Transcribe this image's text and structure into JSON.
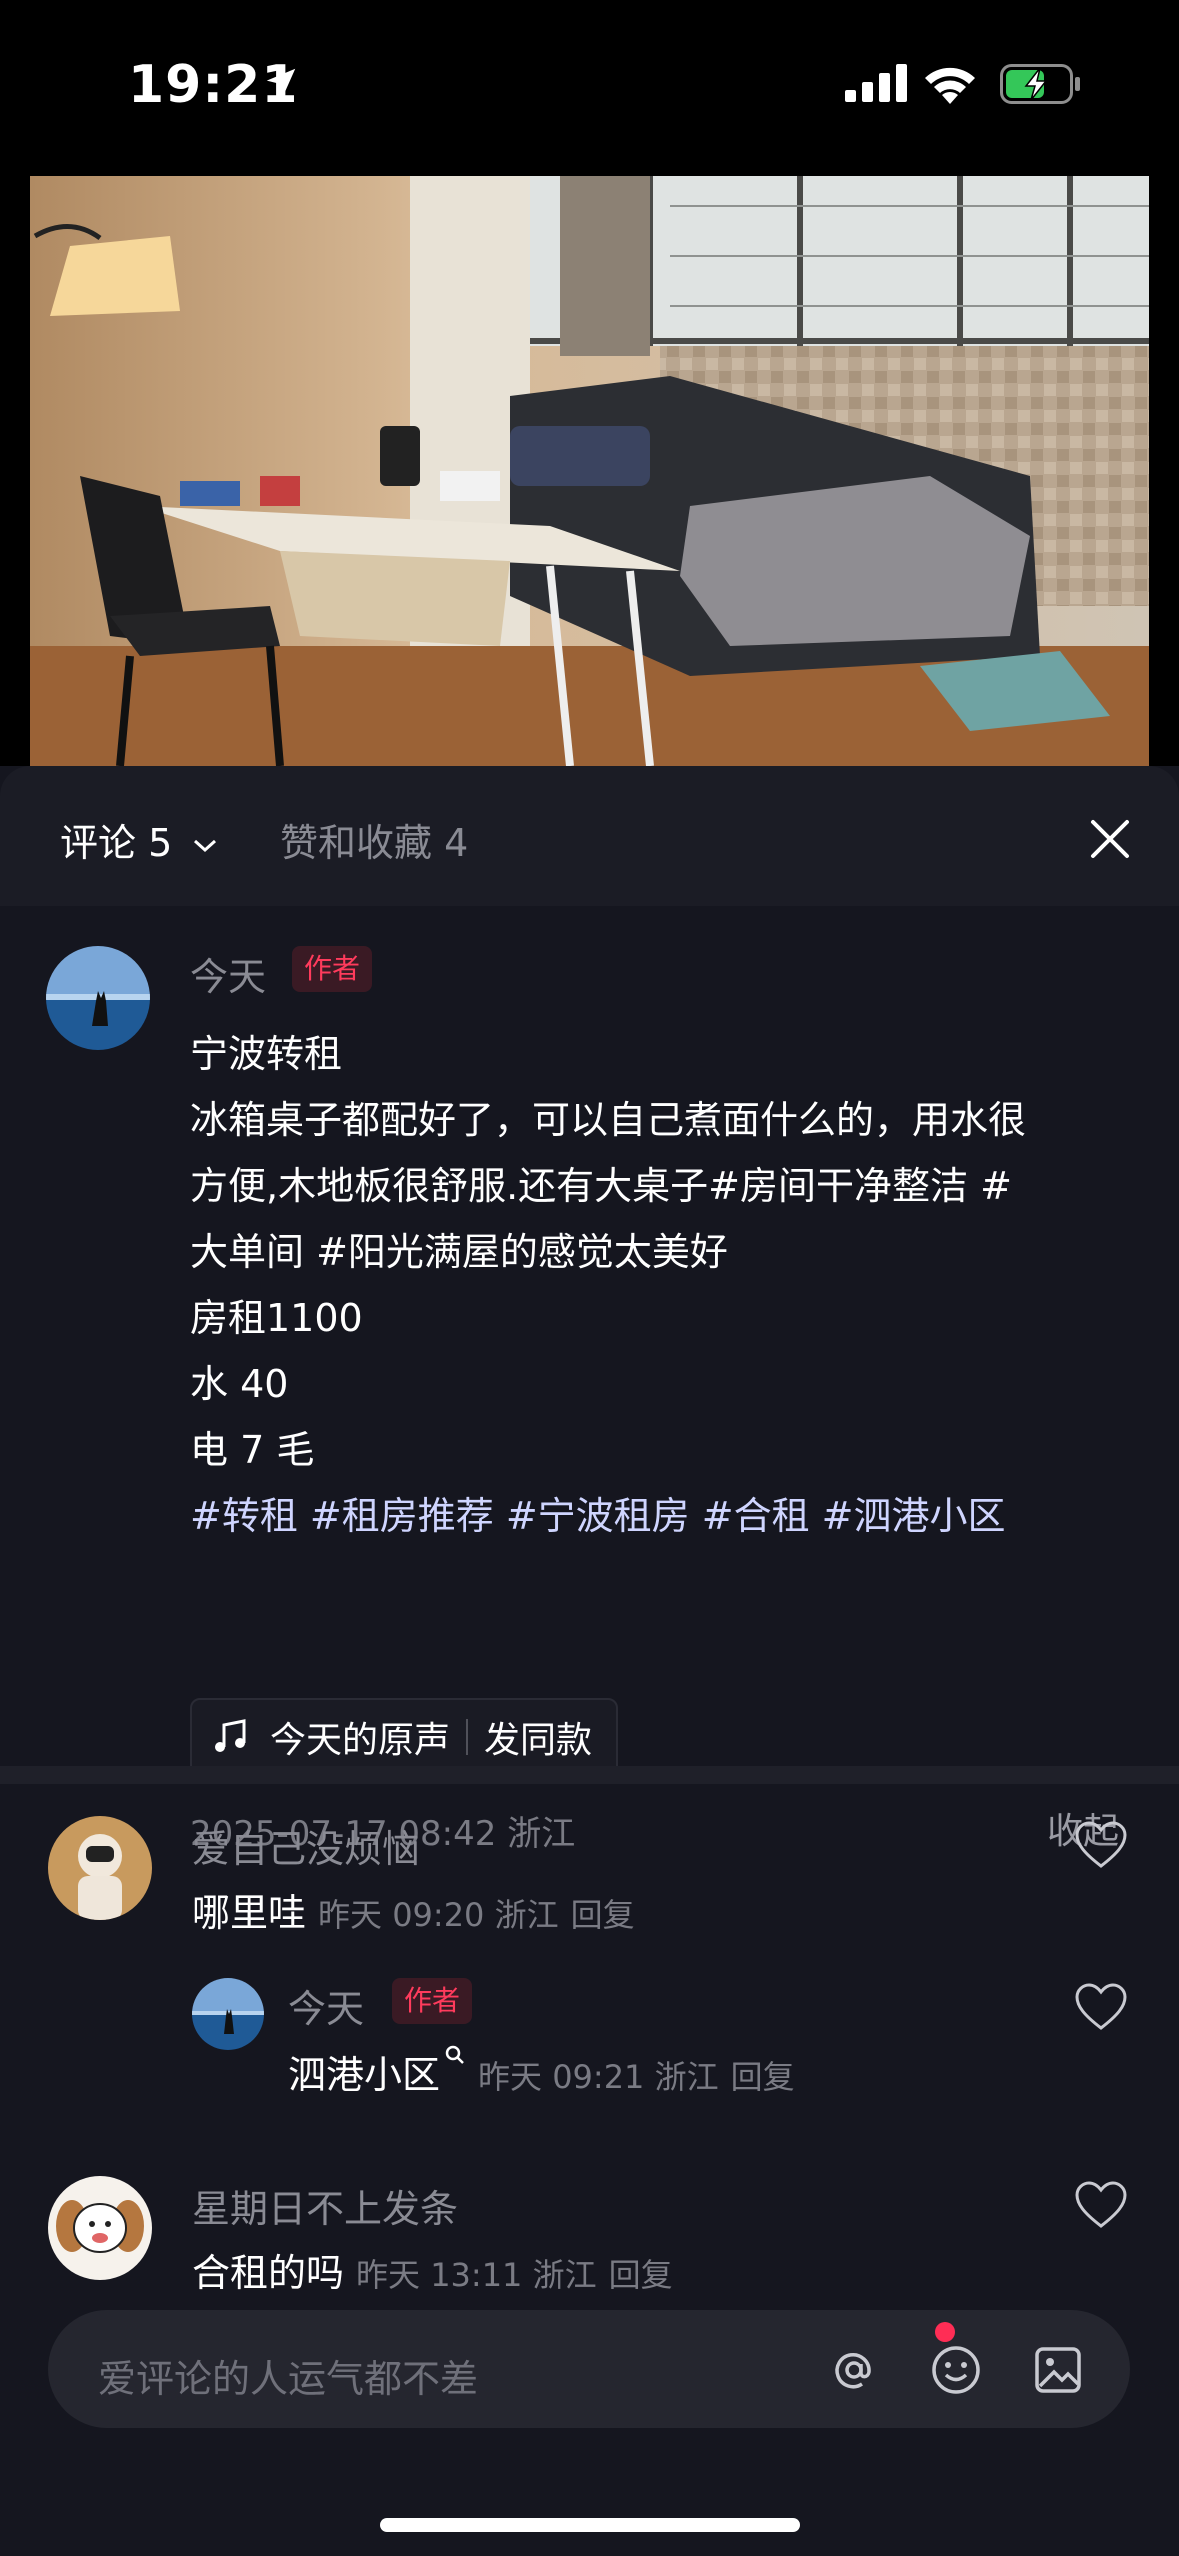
{
  "status_bar": {
    "time": "19:21",
    "signal": "4 bars",
    "battery": "charging"
  },
  "sheet": {
    "tabs": {
      "comments_label": "评论 5",
      "likes_label": "赞和收藏 4"
    }
  },
  "post": {
    "author_name": "今天",
    "author_tag": "作者",
    "lines": [
      "宁波转租",
      "冰箱桌子都配好了，可以自己煮面什么的，用水很",
      "方便,木地板很舒服.还有大桌子#房间干净整洁 #",
      "大单间 #阳光满屋的感觉太美好",
      "房租1100",
      "水 40",
      "电 7 毛",
      "#转租 #租房推荐 #宁波租房 #合租 #泗港小区"
    ],
    "music_label": "今天的原声",
    "music_action": "发同款",
    "timestamp": "2025-07-17 08:42 浙江",
    "collapse_label": "收起"
  },
  "comments": [
    {
      "name": "爱自己没烦恼",
      "text": "哪里哇",
      "meta": "昨天 09:20 浙江",
      "reply_label": "回复"
    },
    {
      "name": "今天",
      "tag": "作者",
      "text": "泗港小区",
      "meta": "昨天 09:21 浙江",
      "reply_label": "回复"
    },
    {
      "name": "星期日不上发条",
      "text": "合租的吗",
      "meta": "昨天 13:11 浙江",
      "reply_label": "回复"
    }
  ],
  "input": {
    "placeholder": "爱评论的人运气都不差"
  },
  "colors": {
    "accent_red": "#ff3b5c",
    "sheet_bg": "#15161f",
    "hashtag": "#cfd5ff"
  }
}
